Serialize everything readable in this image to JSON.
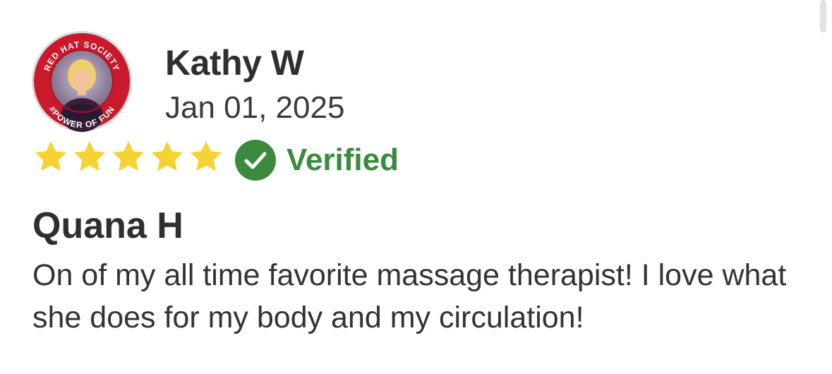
{
  "reviewer": {
    "name": "Kathy W",
    "date": "Jan 01, 2025",
    "avatar": {
      "badge_top_text": "RED HAT SOCIETY",
      "badge_bottom_text": "#POWER OF FUN",
      "ring_color": "#c9192b"
    }
  },
  "rating": {
    "stars": 5,
    "max": 5,
    "star_color": "#f6d233"
  },
  "verified": {
    "label": "Verified",
    "icon": "check-circle-icon",
    "color": "#3b8a3e"
  },
  "review": {
    "title": "Quana H",
    "body": "On of my all time favorite massage therapist! I love what she does for my body and my circulation!"
  }
}
